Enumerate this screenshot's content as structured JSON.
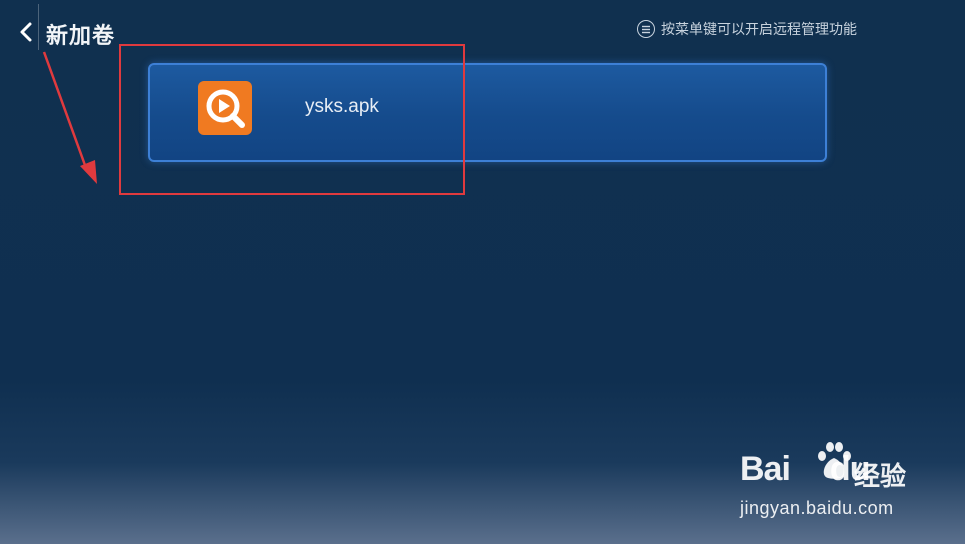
{
  "header": {
    "back_icon": "chevron-left-icon",
    "title": "新加卷"
  },
  "hint": {
    "icon": "menu-circle-icon",
    "text": "按菜单键可以开启远程管理功能"
  },
  "files": [
    {
      "name": "ysks.apk",
      "icon": "orange-play-search-app-icon",
      "icon_color": "#f07a21"
    }
  ],
  "colors": {
    "background": "#10304f",
    "card": "#154b8c",
    "card_border": "#3d80d6",
    "annotation": "#e03a3e"
  },
  "watermark": {
    "logo_part1": "Bai",
    "logo_part2": "du",
    "logo_suffix": "经验",
    "url": "jingyan.baidu.com"
  }
}
